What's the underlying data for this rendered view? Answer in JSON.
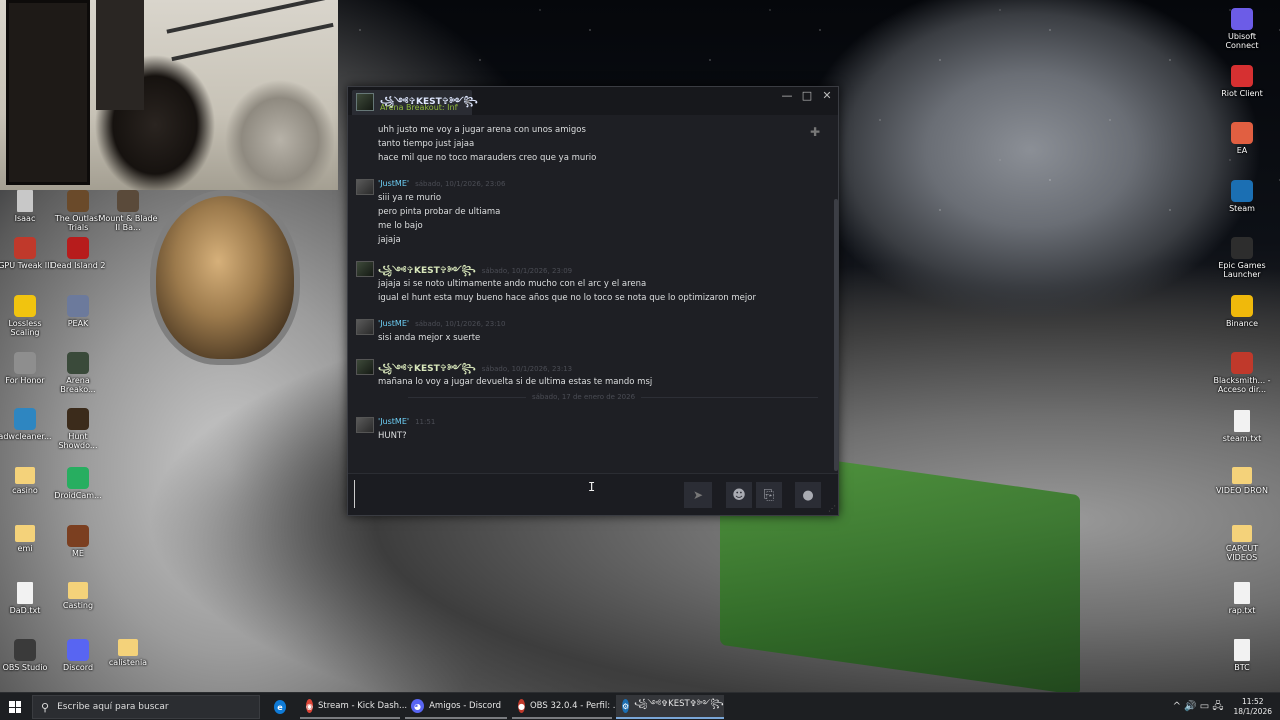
{
  "desktop": {
    "left_icons": [
      {
        "label": "Isaac",
        "kind": "file",
        "color": "#c8c8c8"
      },
      {
        "label": "The Outlast Trials",
        "kind": "app",
        "color": "#6a4a2a"
      },
      {
        "label": "Mount & Blade II Ba...",
        "kind": "app",
        "color": "#5a4a3a"
      },
      {
        "label": "GPU Tweak III",
        "kind": "app",
        "color": "#c0392b"
      },
      {
        "label": "Dead Island 2",
        "kind": "app",
        "color": "#b71c1c"
      },
      {
        "label": "Lossless Scaling",
        "kind": "app",
        "color": "#f1c40f"
      },
      {
        "label": "PEAK",
        "kind": "app",
        "color": "#6c7a9c"
      },
      {
        "label": "For Honor",
        "kind": "app",
        "color": "#8e8e8e"
      },
      {
        "label": "Arena Breako...",
        "kind": "app",
        "color": "#3a4a3a"
      },
      {
        "label": "adwcleaner...",
        "kind": "app",
        "color": "#2e86c1"
      },
      {
        "label": "Hunt Showdo...",
        "kind": "app",
        "color": "#3b2b1b"
      },
      {
        "label": "casino",
        "kind": "folder",
        "color": "#f4d27a"
      },
      {
        "label": "DroidCam...",
        "kind": "app",
        "color": "#27ae60"
      },
      {
        "label": "emi",
        "kind": "folder",
        "color": "#f4d27a"
      },
      {
        "label": "ME",
        "kind": "app",
        "color": "#7b3f20"
      },
      {
        "label": "DaD.txt",
        "kind": "file",
        "color": "#f2f2f2"
      },
      {
        "label": "Casting",
        "kind": "folder",
        "color": "#f4d27a"
      },
      {
        "label": "OBS Studio",
        "kind": "app",
        "color": "#3a3a3a"
      },
      {
        "label": "Discord",
        "kind": "app",
        "color": "#5865f2"
      },
      {
        "label": "calistenia",
        "kind": "folder",
        "color": "#f4d27a"
      }
    ],
    "right_icons": [
      {
        "label": "Ubisoft Connect",
        "kind": "app",
        "color": "#6c5ce7"
      },
      {
        "label": "Riot Client",
        "kind": "app",
        "color": "#d63031"
      },
      {
        "label": "EA",
        "kind": "app",
        "color": "#e15f41"
      },
      {
        "label": "Steam",
        "kind": "app",
        "color": "#1b6fb3"
      },
      {
        "label": "Epic Games Launcher",
        "kind": "app",
        "color": "#2d2d2d"
      },
      {
        "label": "Binance",
        "kind": "app",
        "color": "#f0b90b"
      },
      {
        "label": "Blacksmith... - Acceso dir...",
        "kind": "app",
        "color": "#c0392b"
      },
      {
        "label": "steam.txt",
        "kind": "file",
        "color": "#f2f2f2"
      },
      {
        "label": "VIDEO DRON",
        "kind": "folder",
        "color": "#f4d27a"
      },
      {
        "label": "CAPCUT VIDEOS",
        "kind": "folder",
        "color": "#f4d27a"
      },
      {
        "label": "rap.txt",
        "kind": "file",
        "color": "#f2f2f2"
      },
      {
        "label": "BTC",
        "kind": "file",
        "color": "#f2f2f2"
      }
    ]
  },
  "chat": {
    "tab": {
      "name": "꧁༺✞KEST✞༻꧂",
      "status": "Arena Breakout: Infi"
    },
    "controls": {
      "minimize": "—",
      "maximize": "□",
      "close": "✕"
    },
    "messages": [
      {
        "type": "lines",
        "lines": [
          "uhh justo me voy a jugar arena con unos amigos",
          "tanto tiempo just jajaa",
          "hace mil que no toco marauders creo que ya murio"
        ]
      },
      {
        "type": "group",
        "sender": "'JustME'",
        "sender_kind": "justme",
        "time": "sábado, 10/1/2026, 23:06",
        "lines": [
          "siii ya re murio",
          "pero pinta probar de ultiama",
          "me lo bajo",
          "jajaja"
        ]
      },
      {
        "type": "group",
        "sender": "꧁༺✞KEST✞༻꧂",
        "sender_kind": "kest",
        "time": "sábado, 10/1/2026, 23:09",
        "lines": [
          "jajaja si se noto ultimamente ando mucho con el arc y el arena",
          "igual el hunt esta muy bueno hace años que no lo toco se nota que lo optimizaron mejor"
        ]
      },
      {
        "type": "group",
        "sender": "'JustME'",
        "sender_kind": "justme",
        "time": "sábado, 10/1/2026, 23:10",
        "lines": [
          "sisi anda mejor x suerte"
        ]
      },
      {
        "type": "group",
        "sender": "꧁༺✞KEST✞༻꧂",
        "sender_kind": "kest",
        "time": "sábado, 10/1/2026, 23:13",
        "lines": [
          "mañana lo voy a jugar devuelta si de ultima estas te mando msj"
        ]
      },
      {
        "type": "divider",
        "label": "sábado, 17 de enero de 2026"
      },
      {
        "type": "group",
        "sender": "'JustME'",
        "sender_kind": "justme",
        "time": "11:51",
        "lines": [
          "HUNT?"
        ]
      }
    ],
    "composer": {
      "value": "",
      "send": "➤",
      "emoji": "☻",
      "attach": "⎘",
      "voice": "●"
    }
  },
  "taskbar": {
    "search_placeholder": "Escribe aquí para buscar",
    "apps": [
      {
        "label": "",
        "icon": "e",
        "color": "#0f7bd7",
        "state": "none"
      },
      {
        "label": "Stream - Kick Dash...",
        "icon": "◉",
        "color": "#db4437",
        "state": "open"
      },
      {
        "label": "Amigos - Discord",
        "icon": "◕",
        "color": "#5865f2",
        "state": "open"
      },
      {
        "label": "OBS 32.0.4 - Perfil: ...",
        "icon": "●",
        "color": "#c0392b",
        "state": "open"
      },
      {
        "label": "꧁༺✞KEST✞༻꧂",
        "icon": "⚙",
        "color": "#1b6fb3",
        "state": "active"
      }
    ],
    "tray_icons": "^  🔊  ▭  🖧",
    "time": "11:52",
    "date": "18/1/2026"
  }
}
